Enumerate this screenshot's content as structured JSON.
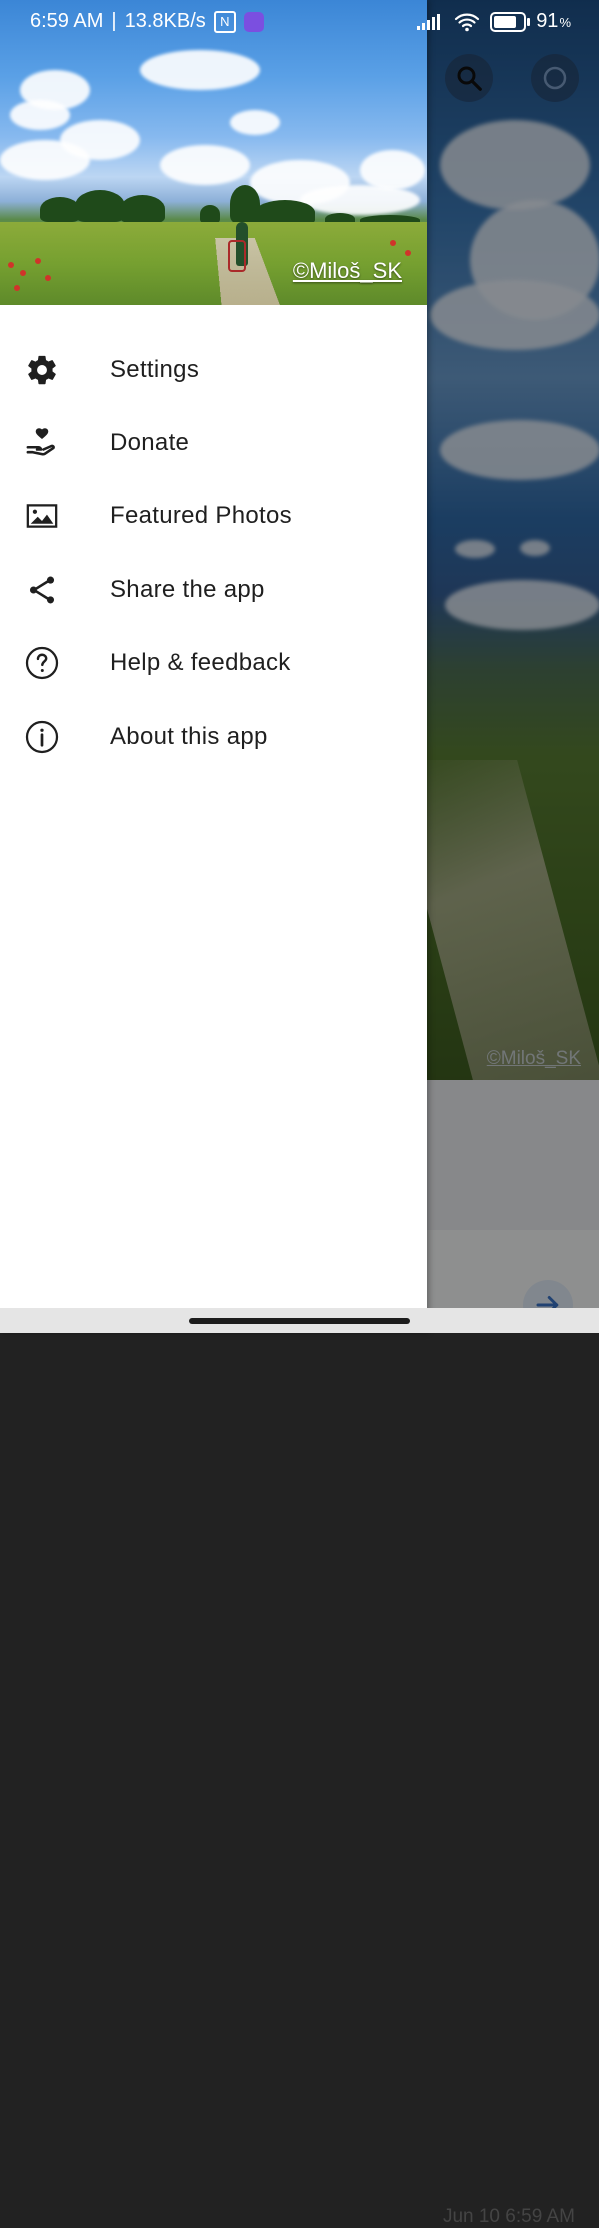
{
  "status_bar": {
    "time": "6:59 AM",
    "separator": "|",
    "network_speed": "13.8KB/s",
    "battery_percent": "91",
    "battery_symbol": "%",
    "battery_level": 0.91,
    "icons": [
      "nfc-icon",
      "app-notification-icon",
      "signal-icon",
      "wifi-icon",
      "battery-icon"
    ]
  },
  "drawer": {
    "header_credit": "©Miloš_SK",
    "menu_items": [
      {
        "label": "Settings",
        "icon": "gear-icon"
      },
      {
        "label": "Donate",
        "icon": "donate-heart-hand-icon"
      },
      {
        "label": "Featured Photos",
        "icon": "image-icon"
      },
      {
        "label": "Share the app",
        "icon": "share-icon"
      },
      {
        "label": "Help & feedback",
        "icon": "help-circle-icon"
      },
      {
        "label": "About this app",
        "icon": "info-circle-icon"
      }
    ]
  },
  "background_app": {
    "photo_credit": "©Miloš_SK",
    "date_text": "Jun 10 6:59 AM",
    "top_buttons": [
      "search-icon",
      "circle-action-icon"
    ],
    "fab_icon": "arrow-right-icon"
  },
  "colors": {
    "drawer_bg": "#ffffff",
    "text_primary": "#1f1f1f",
    "scrim": "rgba(0,0,0,0.42)",
    "app_badge": "#7b4fe0"
  }
}
